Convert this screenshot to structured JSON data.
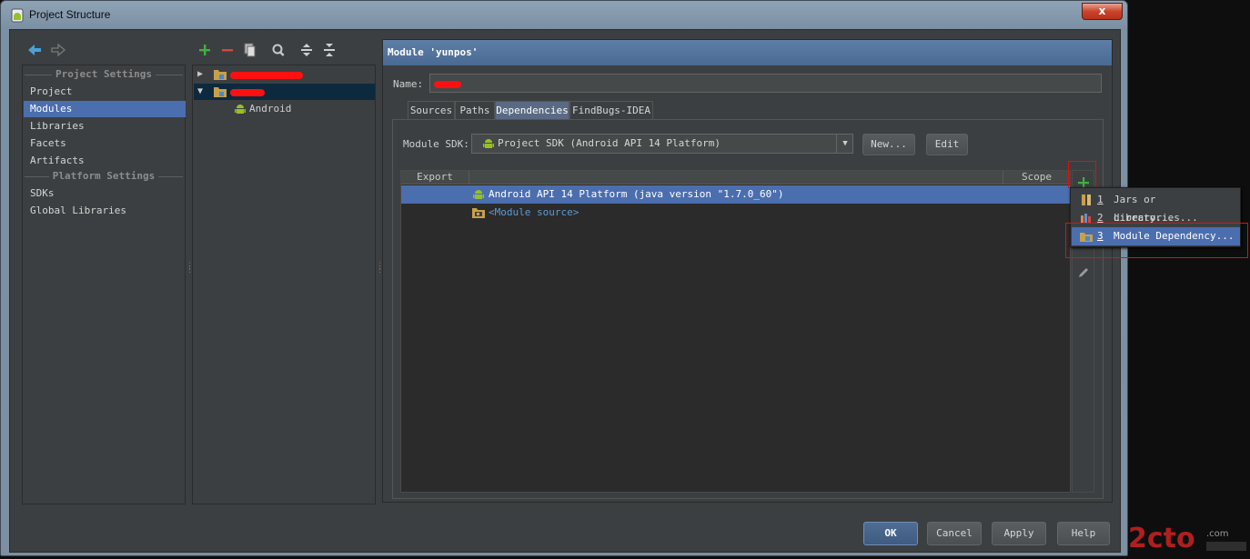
{
  "window": {
    "title": "Project Structure",
    "close_label": "x"
  },
  "left_panel": {
    "sections": [
      {
        "header": "Project Settings",
        "items": [
          "Project",
          "Modules",
          "Libraries",
          "Facets",
          "Artifacts"
        ]
      },
      {
        "header": "Platform Settings",
        "items": [
          "SDKs",
          "Global Libraries"
        ]
      }
    ],
    "selected": "Modules"
  },
  "tree": {
    "child_label": "Android"
  },
  "module": {
    "header": "Module 'yunpos'",
    "name_label": "Name:",
    "tabs": [
      "Sources",
      "Paths",
      "Dependencies",
      "FindBugs-IDEA"
    ],
    "active_tab": "Dependencies",
    "sdk_label": "Module SDK:",
    "sdk_value": "Project SDK (Android API 14 Platform)",
    "new_button": "New...",
    "edit_button": "Edit",
    "table_headers": {
      "export": "Export",
      "scope": "Scope"
    },
    "dependencies": [
      {
        "label": "Android API 14 Platform (java version \"1.7.0_60\")",
        "icon": "android-icon"
      },
      {
        "label": "<Module source>",
        "icon": "module-source-icon"
      }
    ],
    "add_label": "+"
  },
  "popup": {
    "items": [
      {
        "num": "1",
        "label": "Jars or directories...",
        "icon": "jar-icon"
      },
      {
        "num": "2",
        "label": "Library...",
        "icon": "library-icon"
      },
      {
        "num": "3",
        "label": "Module Dependency...",
        "icon": "module-folder-icon"
      }
    ],
    "selected_index": 2
  },
  "buttons": {
    "ok": "OK",
    "cancel": "Cancel",
    "apply": "Apply",
    "help": "Help"
  },
  "colors": {
    "selection": "#4b6eaf",
    "add_green": "#3fb13f",
    "remove_red": "#d9453a",
    "highlight_box": "#e01010",
    "android_green": "#97c024"
  }
}
